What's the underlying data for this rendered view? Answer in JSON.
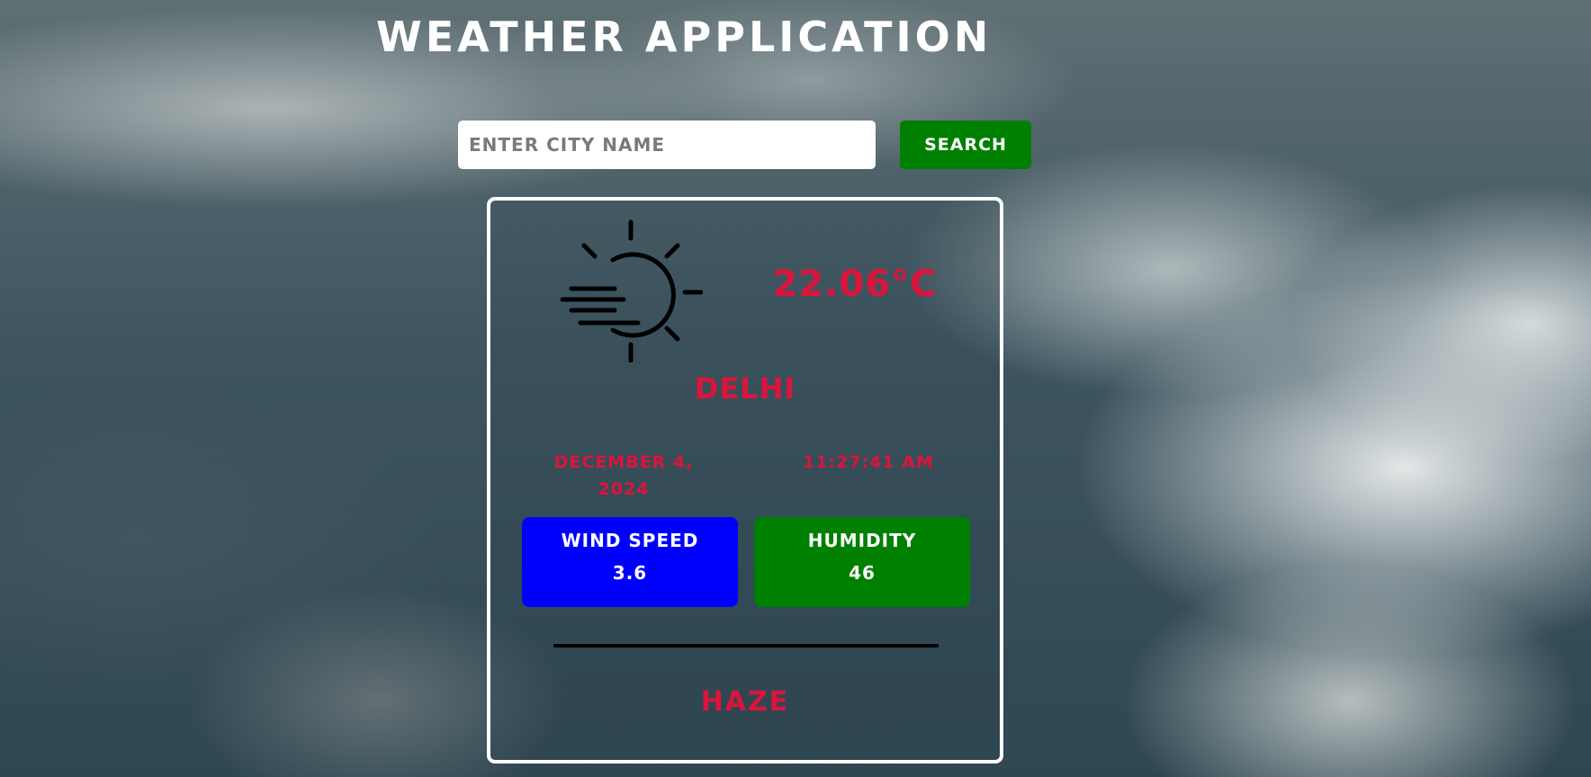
{
  "header": {
    "title": "Weather Application"
  },
  "search": {
    "placeholder": "ENTER CITY NAME",
    "value": "",
    "button_label": "SEARCH"
  },
  "weather": {
    "icon": "haze-sun-icon",
    "temperature": "22.06°C",
    "city": "DELHI",
    "date": "DECEMBER 4, 2024",
    "time": "11:27:41 AM",
    "wind_speed": {
      "label": "WIND SPEED",
      "value": "3.6"
    },
    "humidity": {
      "label": "HUMIDITY",
      "value": "46"
    },
    "condition": "HAZE"
  },
  "colors": {
    "accent_text": "#dc143c",
    "search_button": "#008000",
    "wind_box": "#0000ff",
    "humidity_box": "#008000",
    "card_border": "#ffffff"
  }
}
